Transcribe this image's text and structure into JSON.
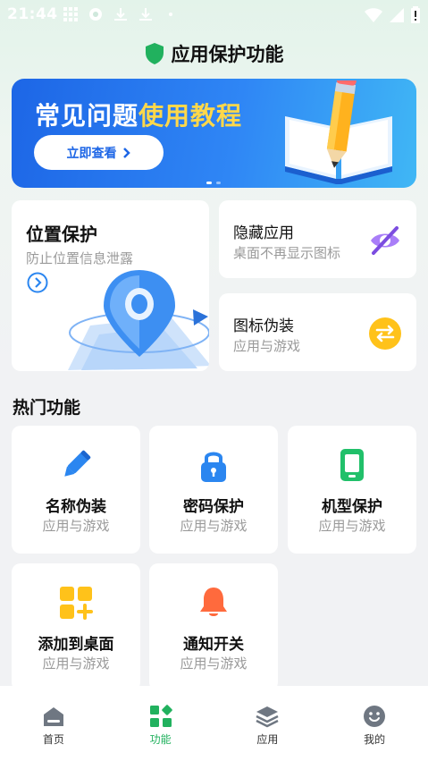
{
  "status_bar": {
    "time": "21:44"
  },
  "header": {
    "title": "应用保护功能"
  },
  "banner": {
    "title_part1": "常见问题",
    "title_part2": "使用教程",
    "button_label": "立即查看"
  },
  "cards": {
    "location": {
      "title": "位置保护",
      "subtitle": "防止位置信息泄露"
    },
    "hide_app": {
      "title": "隐藏应用",
      "subtitle": "桌面不再显示图标"
    },
    "icon_disguise": {
      "title": "图标伪装",
      "subtitle": "应用与游戏"
    }
  },
  "hot_section": {
    "title": "热门功能"
  },
  "features": [
    {
      "title": "名称伪装",
      "subtitle": "应用与游戏",
      "icon": "pencil-icon"
    },
    {
      "title": "密码保护",
      "subtitle": "应用与游戏",
      "icon": "lock-icon"
    },
    {
      "title": "机型保护",
      "subtitle": "应用与游戏",
      "icon": "tablet-icon"
    },
    {
      "title": "添加到桌面",
      "subtitle": "应用与游戏",
      "icon": "add-grid-icon"
    },
    {
      "title": "通知开关",
      "subtitle": "应用与游戏",
      "icon": "bell-icon"
    }
  ],
  "bottom_nav": {
    "items": [
      {
        "label": "首页",
        "icon": "home-icon",
        "active": false
      },
      {
        "label": "功能",
        "icon": "grid-icon",
        "active": true
      },
      {
        "label": "应用",
        "icon": "layers-icon",
        "active": false
      },
      {
        "label": "我的",
        "icon": "smiley-icon",
        "active": false
      }
    ]
  },
  "colors": {
    "accent_green": "#21b15e",
    "banner_blue": "#1d66e6",
    "highlight_yellow": "#ffd84a",
    "icon_blue": "#2b86f0",
    "icon_purple": "#8b5cf6",
    "icon_orange": "#ff6a3d"
  }
}
